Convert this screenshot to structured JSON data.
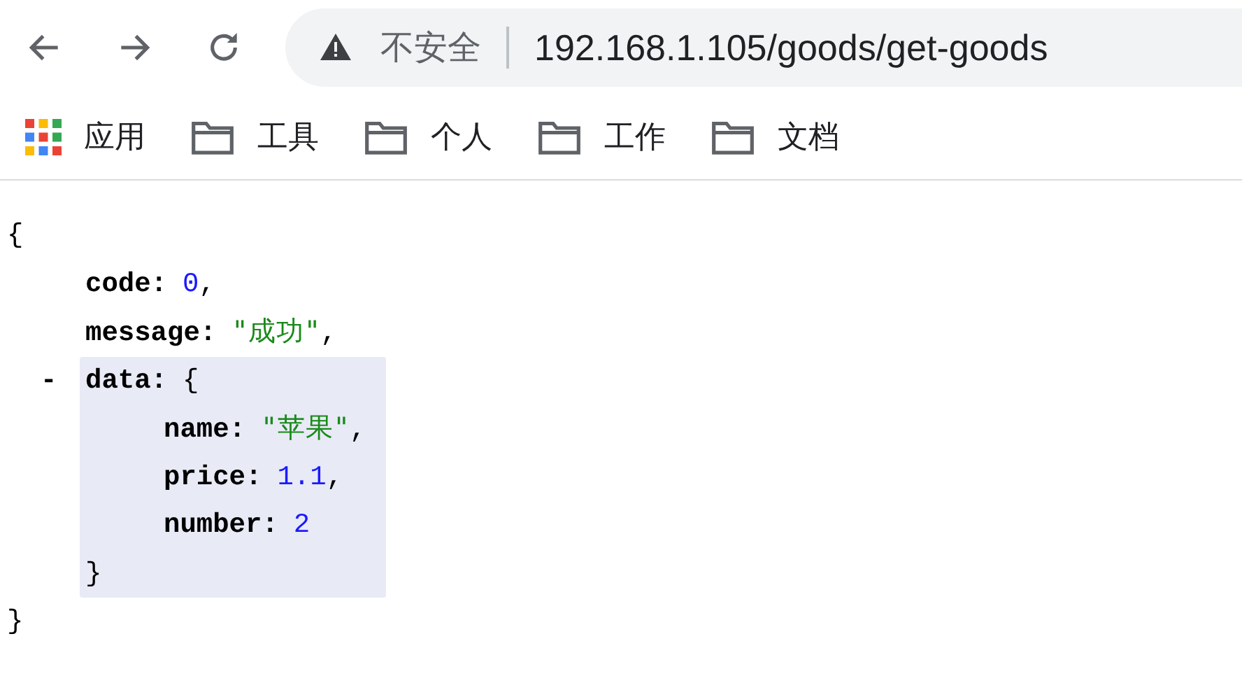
{
  "toolbar": {
    "address_bar": {
      "security_label": "不安全",
      "url": "192.168.1.105/goods/get-goods"
    }
  },
  "bookmarks": [
    {
      "label": "应用",
      "kind": "apps"
    },
    {
      "label": "工具",
      "kind": "folder"
    },
    {
      "label": "个人",
      "kind": "folder"
    },
    {
      "label": "工作",
      "kind": "folder"
    },
    {
      "label": "文档",
      "kind": "folder"
    }
  ],
  "json_view": {
    "open": "{",
    "close": "}",
    "entries": [
      {
        "key": "code:",
        "kind": "number",
        "value": "0",
        "separator": ","
      },
      {
        "key": "message:",
        "kind": "string",
        "value": "\"成功\"",
        "separator": ","
      },
      {
        "key": "data:",
        "kind": "object",
        "toggle": "-",
        "expanded": true,
        "highlighted": true,
        "open": "{",
        "close": "}",
        "children": [
          {
            "key": "name:",
            "kind": "string",
            "value": "\"苹果\"",
            "separator": ","
          },
          {
            "key": "price:",
            "kind": "number",
            "value": "1.1",
            "separator": ","
          },
          {
            "key": "number:",
            "kind": "number",
            "value": "2"
          }
        ]
      }
    ]
  }
}
